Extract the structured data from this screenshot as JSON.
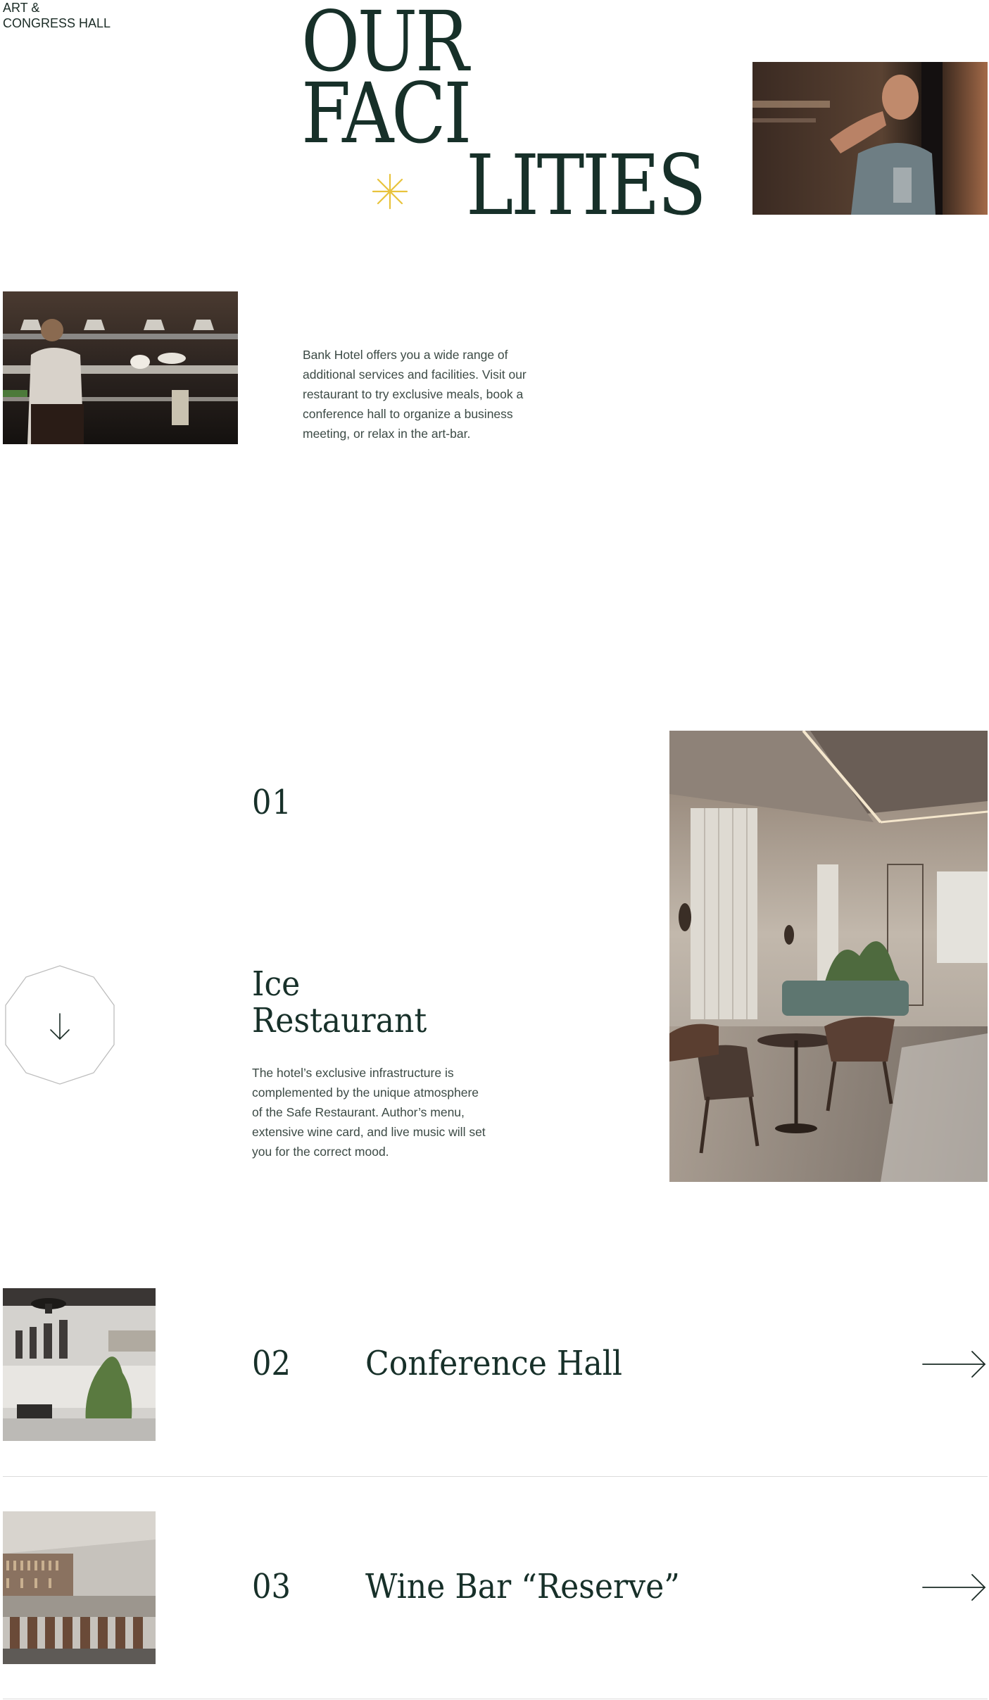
{
  "header": {
    "tag_line1": "ART &",
    "tag_line2": "CONGRESS HALL"
  },
  "hero": {
    "title_line1": "OUR",
    "title_line2": "FACI",
    "title_line3": "LITIES",
    "star_color": "#e8c33c"
  },
  "intro": {
    "text": "Bank Hotel offers you a wide range of additional services and facilities. Visit our restaurant to try exclusive meals, book a conference hall to organize a business meeting, or relax in the art-bar."
  },
  "facilities": [
    {
      "number": "01",
      "title_line1": "Ice",
      "title_line2": "Restaurant",
      "description": "The hotel’s exclusive infrastructure is complemented by the unique atmosphere of the Safe Restaurant. Author’s menu, extensive wine card, and live music will set you for the correct mood."
    },
    {
      "number": "02",
      "title": "Conference Hall"
    },
    {
      "number": "03",
      "title": "Wine Bar “Reserve”"
    }
  ],
  "colors": {
    "text_dark": "#173029",
    "body_text": "#3c4a45",
    "divider": "#dcdcdc"
  }
}
